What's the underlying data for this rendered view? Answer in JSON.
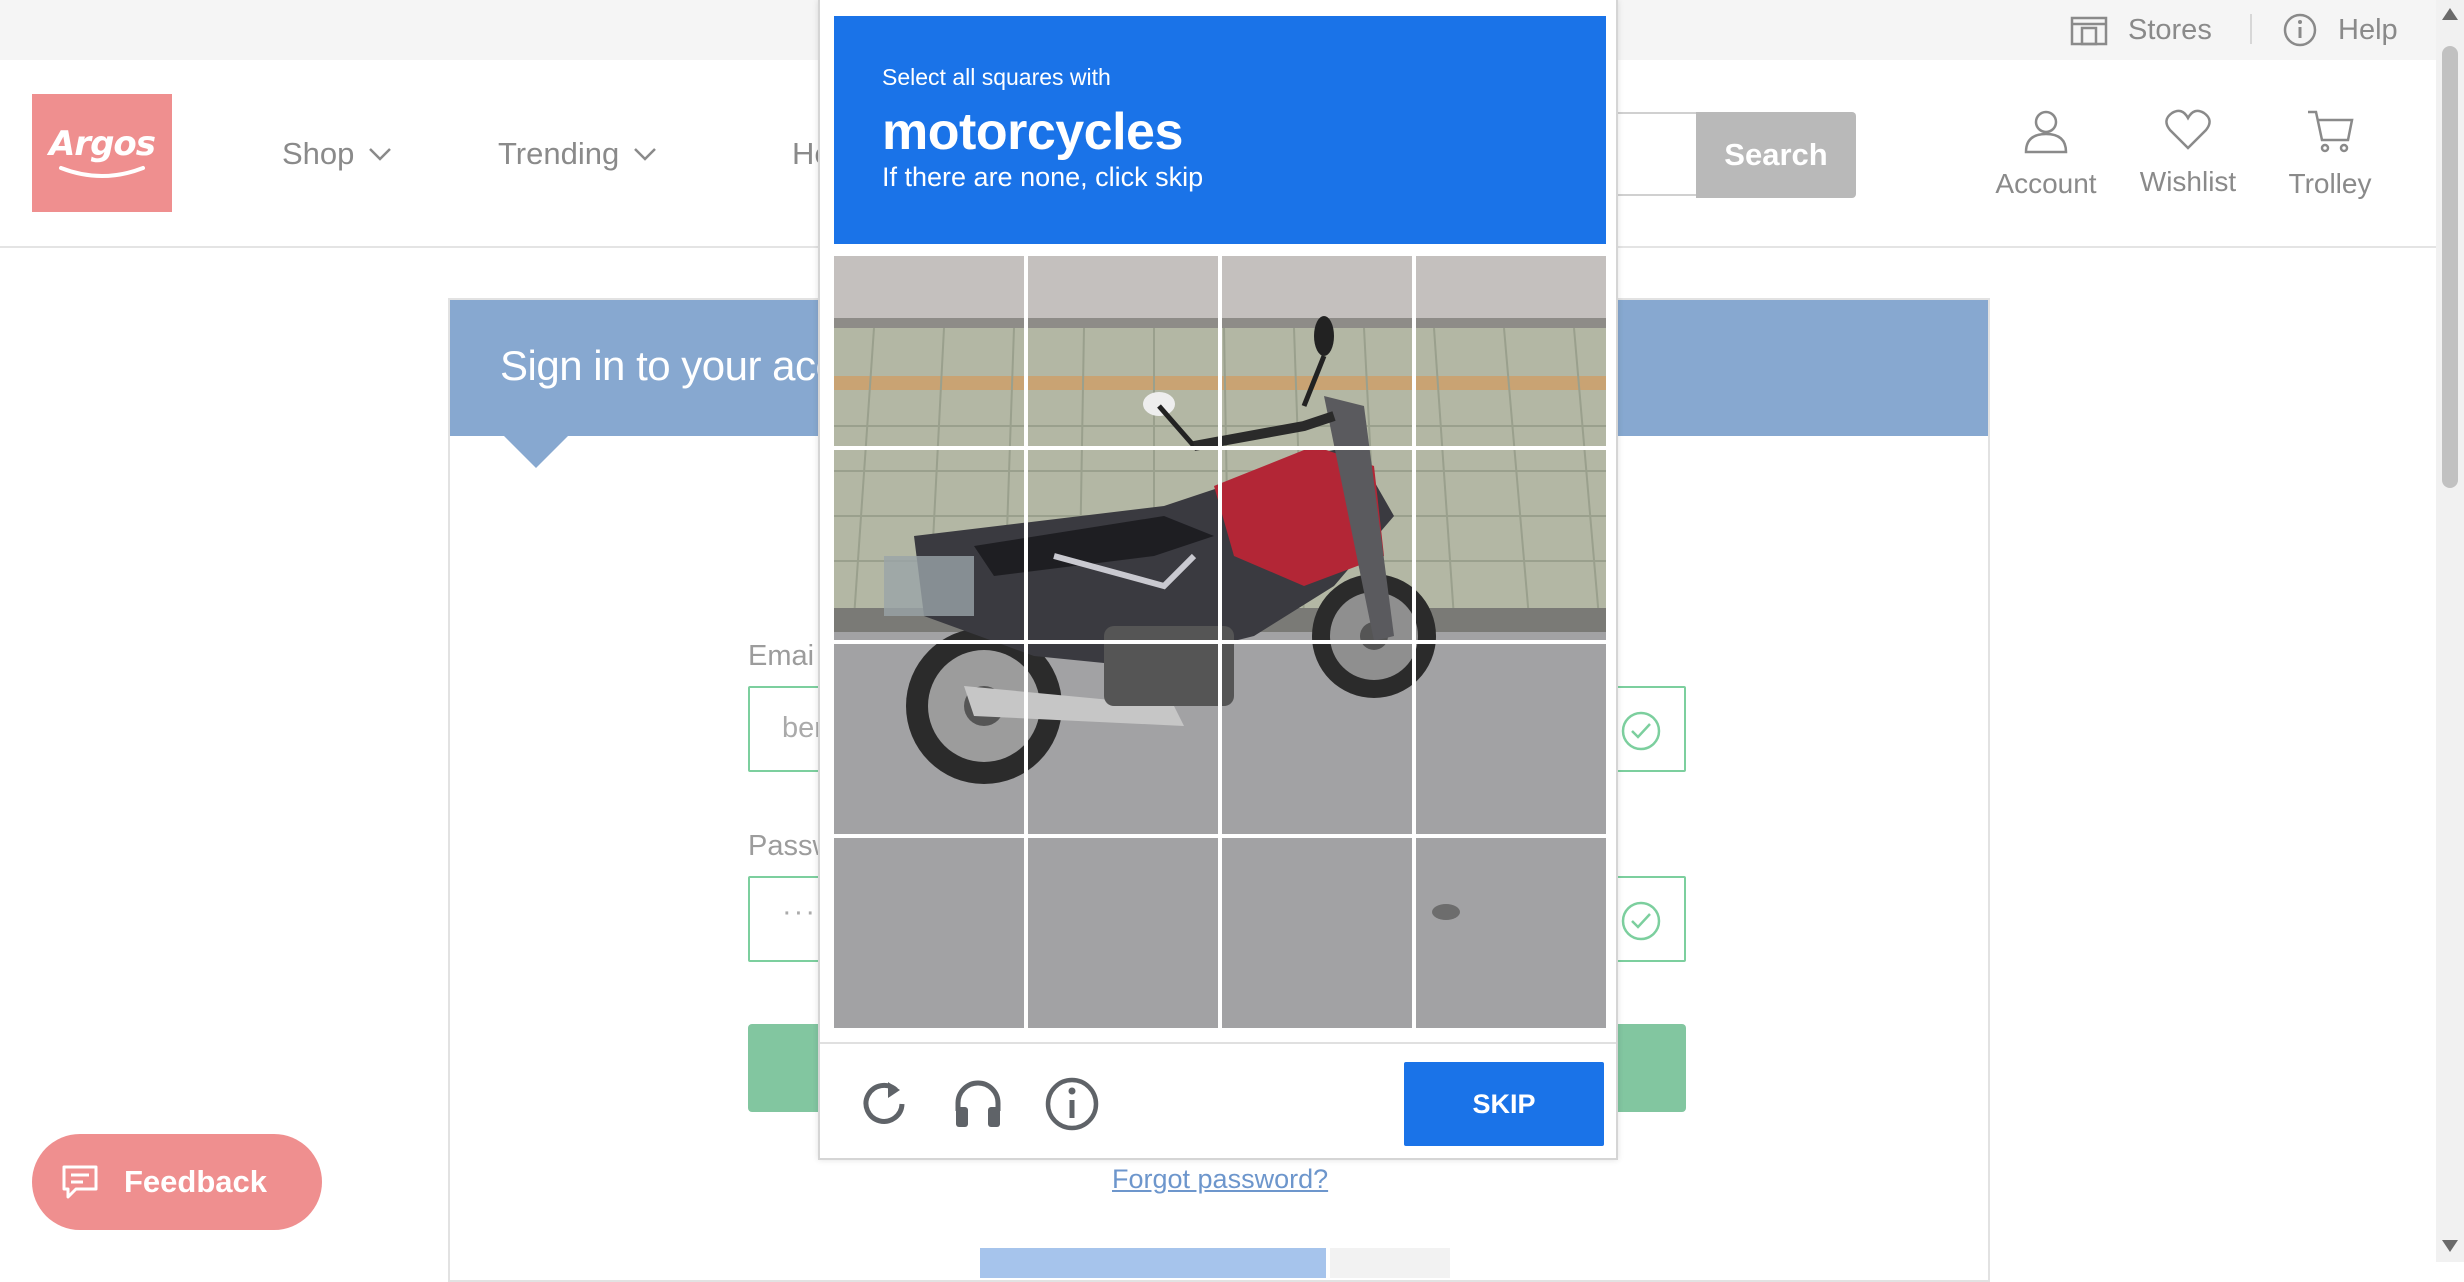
{
  "utility_bar": {
    "stores_label": "Stores",
    "help_label": "Help"
  },
  "header": {
    "logo_text": "Argos",
    "nav": [
      {
        "label": "Shop",
        "has_chevron": true
      },
      {
        "label": "Trending",
        "has_chevron": true
      },
      {
        "label": "He",
        "has_chevron": false
      }
    ],
    "search": {
      "button_label": "Search",
      "placeholder": ""
    },
    "icons": {
      "account_label": "Account",
      "wishlist_label": "Wishlist",
      "trolley_label": "Trolley"
    }
  },
  "signin": {
    "title": "Sign in to your accou",
    "email_label": "Emai",
    "email_value": "ber",
    "password_label": "Passw",
    "password_value": "·····",
    "forgot_password": "Forgot password?"
  },
  "feedback": {
    "label": "Feedback"
  },
  "captcha": {
    "instruction": "Select all squares with",
    "target": "motorcycles",
    "sub_instruction": "If there are none, click skip",
    "grid_rows": 4,
    "grid_cols": 4,
    "skip_label": "SKIP",
    "accent": "#1a73e8"
  },
  "colors": {
    "brand": "#ef8f8f",
    "signin_header": "#87a8d0",
    "valid_green": "#7ccf9e"
  }
}
